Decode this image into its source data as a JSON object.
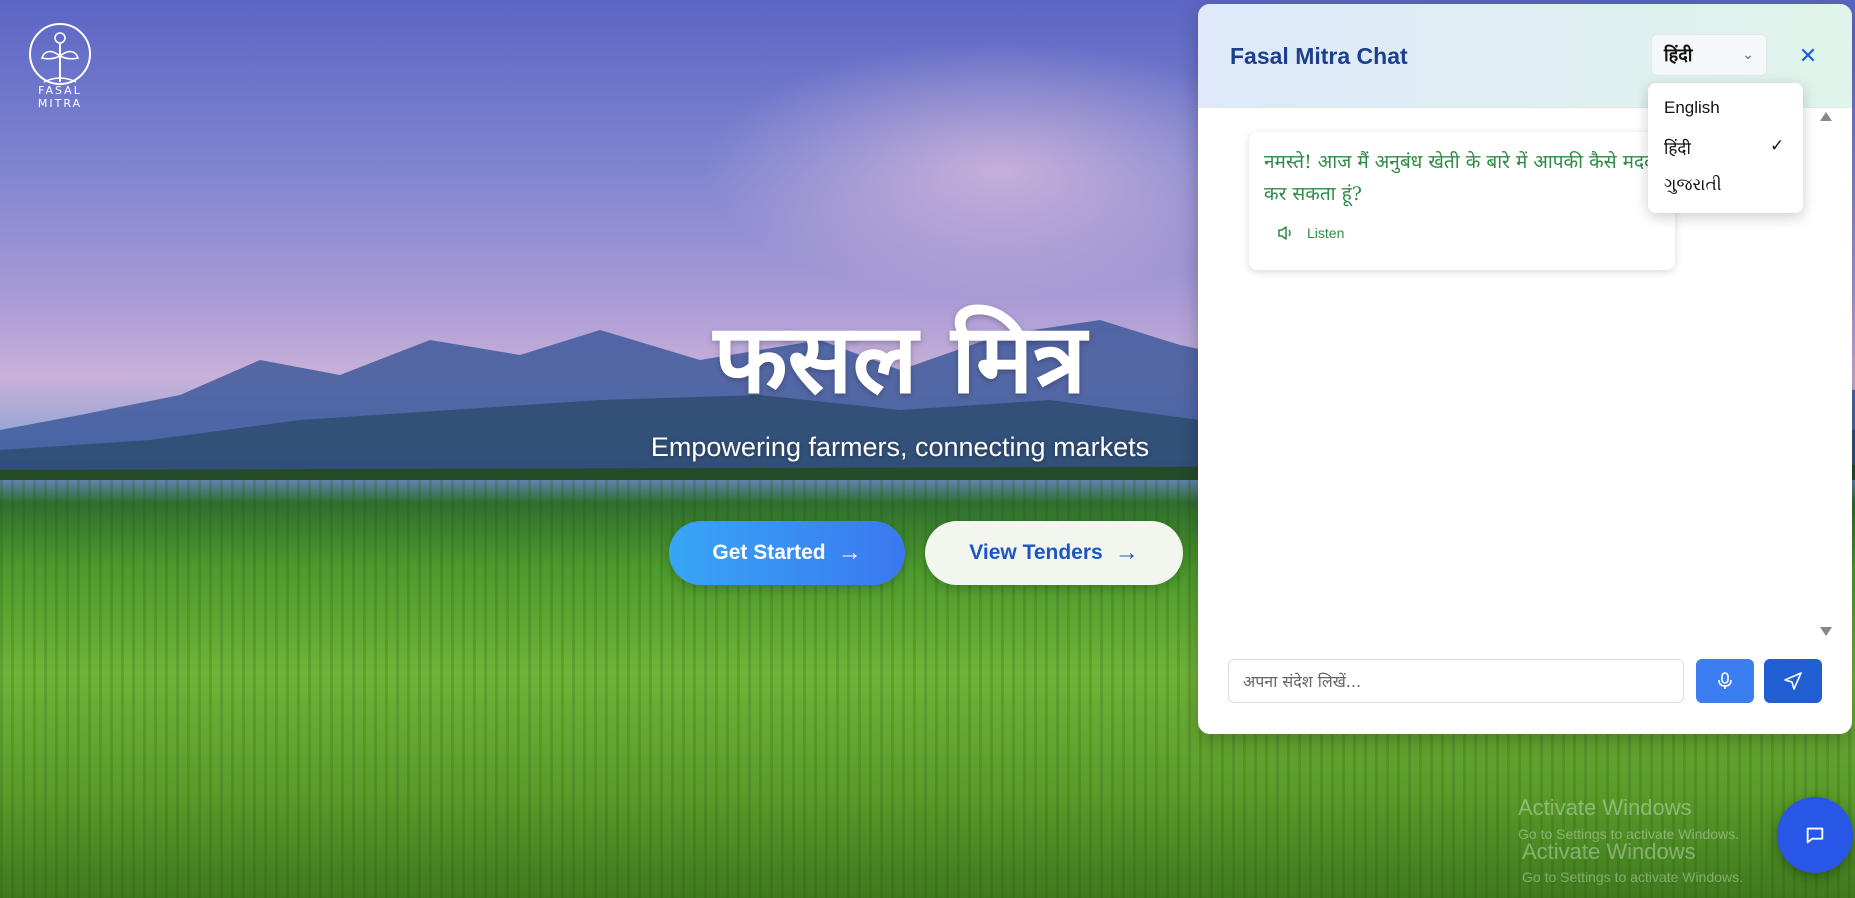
{
  "brand": {
    "logo_text": "FASAL MITRA"
  },
  "hero": {
    "title": "फसल मित्र",
    "subtitle": "Empowering farmers, connecting markets",
    "primary_button": "Get Started",
    "secondary_button": "View Tenders"
  },
  "chat": {
    "title": "Fasal Mitra Chat",
    "language_selected": "हिंदी",
    "messages": [
      {
        "text": "नमस्ते! आज मैं अनुबंध खेती के बारे में आपकी कैसे मदद कर सकता हूं?",
        "listen_label": "Listen"
      }
    ],
    "input_placeholder": "अपना संदेश लिखें...",
    "language_options": [
      "English",
      "हिंदी",
      "ગુજરાતી"
    ]
  },
  "watermark": {
    "line1": "Activate Windows",
    "line2": "Go to Settings to activate Windows.",
    "line3": "Activate Windows",
    "line4": "Go to Settings to activate Windows."
  },
  "colors": {
    "accent": "#3a78f0",
    "chat_title": "#1e3f8c",
    "message_text": "#2f8a47"
  }
}
